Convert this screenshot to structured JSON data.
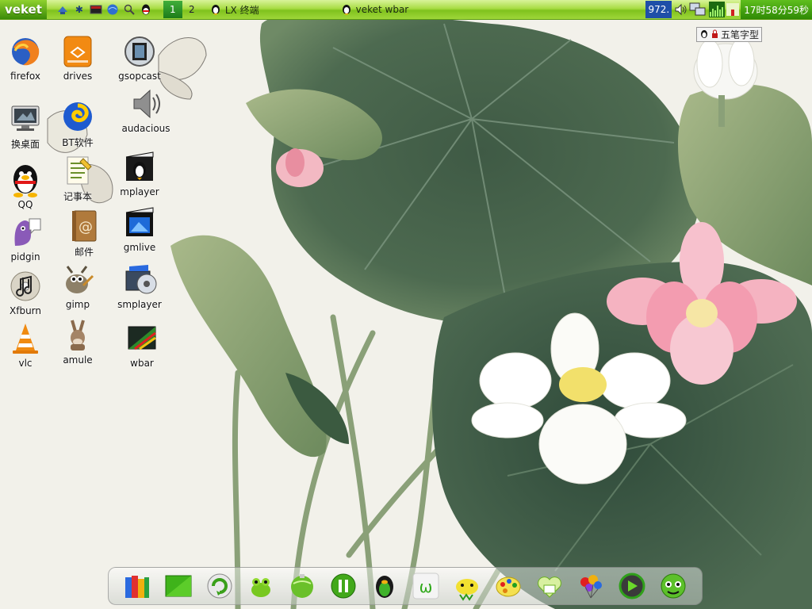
{
  "panel": {
    "menu_label": "veket",
    "workspaces": [
      "1",
      "2"
    ],
    "tasks": [
      {
        "label": "LX 终端",
        "icon": "tux-icon"
      },
      {
        "label": "veket wbar",
        "icon": "tux-icon"
      }
    ],
    "net_value": "972.",
    "clock": "17时58分59秒"
  },
  "ime": {
    "label": "五笔字型"
  },
  "desktop": {
    "icons": [
      {
        "label": "firefox",
        "icon": "firefox-icon"
      },
      {
        "label": "drives",
        "icon": "drives-icon"
      },
      {
        "label": "gsopcast",
        "icon": "gsopcast-icon"
      },
      {
        "label": "换桌面",
        "icon": "desktop-switch-icon"
      },
      {
        "label": "BT软件",
        "icon": "bt-icon"
      },
      {
        "label": "audacious",
        "icon": "speaker-icon"
      },
      {
        "label": "QQ",
        "icon": "qq-penguin-icon"
      },
      {
        "label": "记事本",
        "icon": "notepad-icon"
      },
      {
        "label": "mplayer",
        "icon": "mplayer-icon"
      },
      {
        "label": "pidgin",
        "icon": "pidgin-icon"
      },
      {
        "label": "邮件",
        "icon": "mail-icon"
      },
      {
        "label": "gmlive",
        "icon": "gmlive-icon"
      },
      {
        "label": "Xfburn",
        "icon": "xfburn-icon"
      },
      {
        "label": "gimp",
        "icon": "gimp-icon"
      },
      {
        "label": "smplayer",
        "icon": "smplayer-icon"
      },
      {
        "label": "vlc",
        "icon": "vlc-cone-icon"
      },
      {
        "label": "amule",
        "icon": "amule-icon"
      },
      {
        "label": "wbar",
        "icon": "wbar-icon"
      }
    ]
  },
  "dock": {
    "items": [
      "books-icon",
      "green-screen-icon",
      "refresh-icon",
      "frog-icon",
      "globe-icon",
      "pause-icon",
      "tux-icon",
      "w-icon",
      "chick-icon",
      "palette-icon",
      "heart-icon",
      "balloon-icon",
      "frame-icon",
      "robot-icon"
    ]
  },
  "colors": {
    "panel_green": "#8fcf2a",
    "clock_green": "#3a9410",
    "net_blue": "#1f4fa8"
  }
}
